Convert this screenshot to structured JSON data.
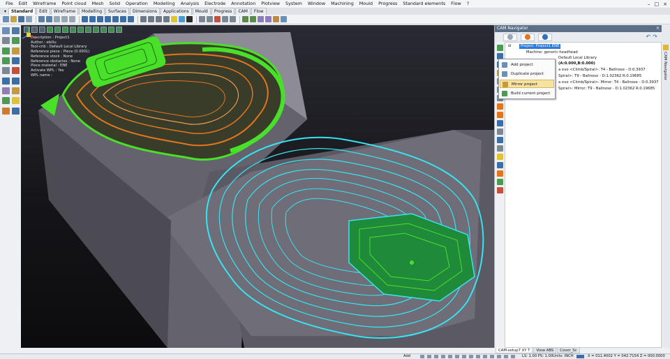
{
  "menubar": {
    "items": [
      "File",
      "Edit",
      "Wireframe",
      "Point cloud",
      "Mesh",
      "Solid",
      "Operation",
      "Modelling",
      "Analysis",
      "Electrode",
      "Annotation",
      "Plotview",
      "System",
      "Window",
      "Machining",
      "Mould",
      "Progress",
      "Standard elements",
      "Flow",
      "?"
    ],
    "window_controls": [
      "–",
      "□",
      "×"
    ]
  },
  "tabs": {
    "items": [
      "Standard",
      "Edit",
      "Wireframe",
      "Modelling",
      "Surfaces",
      "Dimensions",
      "Applications",
      "Mould",
      "Progress",
      "CAM",
      "Flow"
    ],
    "active": "Standard"
  },
  "viewport": {
    "info": [
      {
        "k": "Description : ",
        "v": "Project1"
      },
      {
        "k": "Author : ",
        "v": "ebiliu"
      },
      {
        "k": "Tool-crib : ",
        "v": "Default Local Library"
      },
      {
        "k": "Reference piece : ",
        "v": "Piece (0.0001)"
      },
      {
        "k": "Reference stock : ",
        "v": "None"
      },
      {
        "k": "Reference obstacles : ",
        "v": "None"
      },
      {
        "k": "Piece material : ",
        "v": "ENE"
      },
      {
        "k": "Activate WPL : ",
        "v": "Yes"
      },
      {
        "k": "WPL name : ",
        "v": ""
      }
    ],
    "colors": {
      "green_toolpath": "#49e02a",
      "orange_toolpath": "#e2761e",
      "cyan_toolpath": "#35e6f2",
      "part": "#7b7a85"
    }
  },
  "navigator": {
    "title": "CAM Navigator",
    "close": "×",
    "tree": {
      "project": "Project: Project1 ENE",
      "machine": "Machine: generic-headhead",
      "library": "Default Local Library",
      "origin": "(A:0.000,B:0.000)",
      "ops": [
        "a evo <Climb/Spiral>: T4 - Ballnose - D:0.3937",
        "Spiral>: T9 - Ballnose - D:1.02362 R:0.19685",
        "a evo <Climb/Spiral>: Mirror: T4 - Ballnose - D:0.3937",
        "Spiral>: Mirror: T9 - Ballnose - D:1.02362 R:0.19685"
      ]
    }
  },
  "context_menu": {
    "items": [
      "Add project",
      "Duplicate project",
      "Mirror project",
      "Build current project"
    ],
    "highlighted": "Mirror project"
  },
  "right_dock": {
    "label": "CAM Navigator"
  },
  "view_tabs": [
    "CAM-setup7 XY T",
    "View ABS",
    "Cover_Sc"
  ],
  "statusbar": {
    "mode": "Add",
    "ls_ps": "LS: 1.00 PS: 1.00",
    "units": "Units: INCH",
    "coords": "X = 011.4002 Y = 042.7154 Z = 000.0000"
  }
}
